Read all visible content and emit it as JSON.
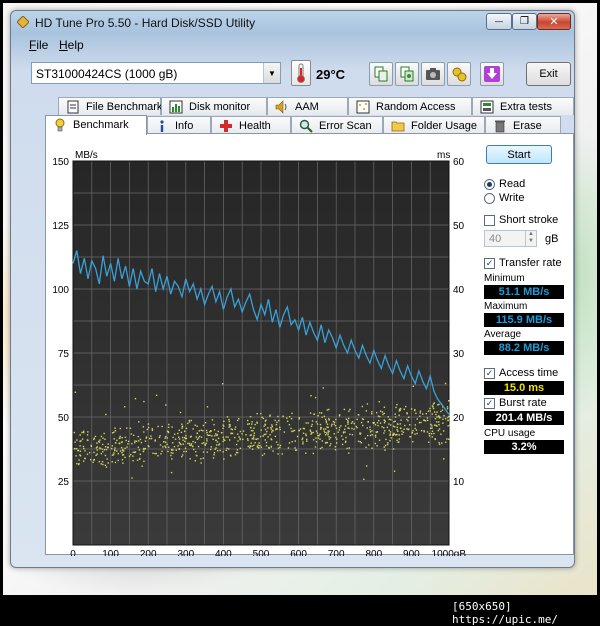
{
  "window": {
    "title": "HD Tune Pro 5.50 - Hard Disk/SSD Utility",
    "min_glyph": "—",
    "max_glyph": "❐",
    "close_glyph": "✕"
  },
  "menu": [
    {
      "accel": "F",
      "rest": "ile"
    },
    {
      "accel": "H",
      "rest": "elp"
    }
  ],
  "toolbar": {
    "drive": "ST31000424CS (1000 gB)",
    "temperature": "29°C",
    "exit_label": "Exit",
    "icons": [
      "copy-text-icon",
      "copy-image-icon",
      "camera-icon",
      "options-icon",
      "download-icon"
    ]
  },
  "tabs_top": [
    {
      "label": "File Benchmark",
      "icon": "file-benchmark-icon"
    },
    {
      "label": "Disk monitor",
      "icon": "disk-monitor-icon"
    },
    {
      "label": "AAM",
      "icon": "speaker-icon"
    },
    {
      "label": "Random Access",
      "icon": "random-access-icon"
    },
    {
      "label": "Extra tests",
      "icon": "extra-tests-icon"
    }
  ],
  "tabs_bottom": [
    {
      "label": "Benchmark",
      "icon": "benchmark-icon",
      "active": true
    },
    {
      "label": "Info",
      "icon": "info-icon"
    },
    {
      "label": "Health",
      "icon": "health-cross-icon"
    },
    {
      "label": "Error Scan",
      "icon": "magnifier-icon"
    },
    {
      "label": "Folder Usage",
      "icon": "folder-icon"
    },
    {
      "label": "Erase",
      "icon": "trash-icon"
    }
  ],
  "chart_data": {
    "type": "line",
    "y_left_unit": "MB/s",
    "y_right_unit": "ms",
    "y_left_ticks": [
      25,
      50,
      75,
      100,
      125,
      150
    ],
    "y_right_ticks": [
      10,
      20,
      30,
      40,
      50,
      60
    ],
    "x_ticks": [
      "0",
      "100",
      "200",
      "300",
      "400",
      "500",
      "600",
      "700",
      "800",
      "900",
      "1000gB"
    ],
    "ylim_left": [
      0,
      150
    ],
    "ylim_right": [
      0,
      60
    ],
    "xlim": [
      0,
      1000
    ],
    "grid": true,
    "series": [
      {
        "color": "#3aa0d8",
        "x": [
          0,
          10,
          20,
          30,
          40,
          50,
          60,
          70,
          80,
          90,
          100,
          110,
          120,
          130,
          140,
          150,
          160,
          170,
          180,
          190,
          200,
          210,
          220,
          230,
          240,
          250,
          260,
          270,
          280,
          290,
          300,
          310,
          320,
          330,
          340,
          350,
          360,
          370,
          380,
          390,
          400,
          410,
          420,
          430,
          440,
          450,
          460,
          470,
          480,
          490,
          500,
          510,
          520,
          530,
          540,
          550,
          560,
          570,
          580,
          590,
          600,
          610,
          620,
          630,
          640,
          650,
          660,
          670,
          680,
          690,
          700,
          710,
          720,
          730,
          740,
          750,
          760,
          770,
          780,
          790,
          800,
          810,
          820,
          830,
          840,
          850,
          860,
          870,
          880,
          890,
          900,
          910,
          920,
          930,
          940,
          950,
          960,
          970,
          980,
          990,
          1000
        ],
        "values": [
          110,
          115,
          106,
          112,
          104,
          111,
          108,
          102,
          113,
          105,
          110,
          103,
          112,
          104,
          109,
          101,
          108,
          100,
          107,
          103,
          102,
          108,
          99,
          106,
          100,
          105,
          98,
          103,
          101,
          97,
          104,
          99,
          102,
          96,
          100,
          94,
          98,
          101,
          95,
          99,
          92,
          97,
          100,
          93,
          96,
          91,
          95,
          98,
          92,
          88,
          94,
          90,
          96,
          87,
          92,
          85,
          90,
          93,
          86,
          88,
          84,
          89,
          82,
          87,
          83,
          80,
          86,
          79,
          84,
          81,
          77,
          82,
          78,
          75,
          80,
          76,
          73,
          78,
          74,
          71,
          76,
          72,
          69,
          74,
          70,
          67,
          72,
          68,
          65,
          70,
          66,
          63,
          68,
          64,
          61,
          66,
          60,
          57,
          55,
          53,
          51
        ]
      }
    ],
    "access_scatter": {
      "color": "#d4d65a",
      "band_ms_low": [
        13,
        17
      ],
      "band_ms_high": [
        17,
        22
      ],
      "range_ms": [
        10,
        26
      ]
    }
  },
  "controls": {
    "start_label": "Start",
    "read_label": "Read",
    "write_label": "Write",
    "short_stroke_label": "Short stroke",
    "short_stroke_value": "40",
    "short_stroke_unit": "gB",
    "transfer_rate_label": "Transfer rate",
    "minimum_label": "Minimum",
    "minimum_value": "51.1 MB/s",
    "maximum_label": "Maximum",
    "maximum_value": "115.9 MB/s",
    "average_label": "Average",
    "average_value": "88.2 MB/s",
    "access_time_label": "Access time",
    "access_time_value": "15.0 ms",
    "burst_rate_label": "Burst rate",
    "burst_rate_value": "201.4 MB/s",
    "cpu_usage_label": "CPU usage",
    "cpu_usage_value": "3.2%",
    "checked_glyph": "✓",
    "spin_up": "▲",
    "spin_down": "▼",
    "dropdown_arrow": "▼"
  },
  "watermark": "[650x650] https://upic.me/"
}
